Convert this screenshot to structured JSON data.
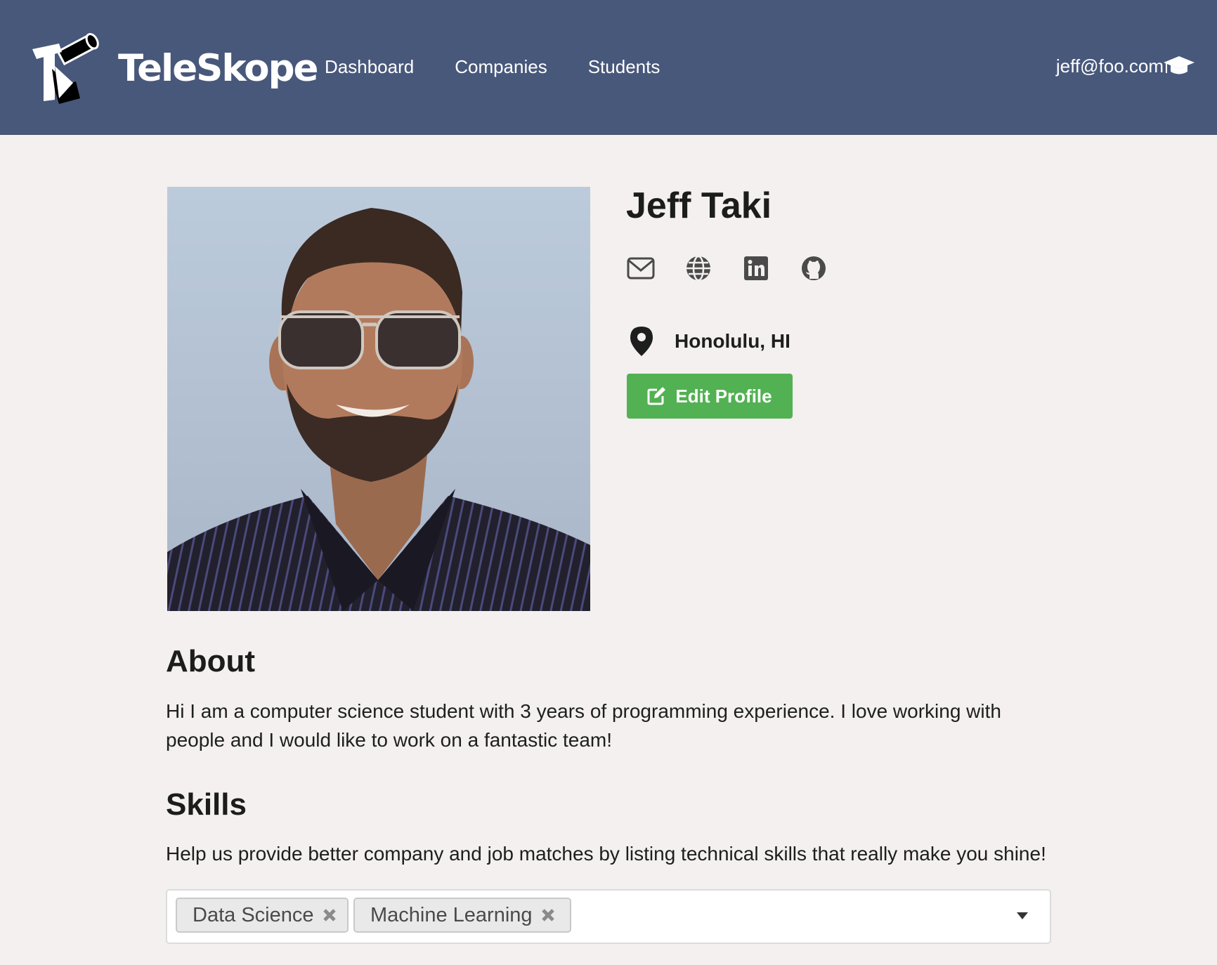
{
  "header": {
    "brand": "TeleSkope",
    "nav": [
      "Dashboard",
      "Companies",
      "Students"
    ],
    "user_email": "jeff@foo.com",
    "user_icon": "graduation-cap-icon",
    "bg_color": "#48587b"
  },
  "profile": {
    "name": "Jeff Taki",
    "social_icons": [
      "envelope-icon",
      "globe-icon",
      "linkedin-icon",
      "github-icon"
    ],
    "location": "Honolulu, HI",
    "edit_button": "Edit Profile",
    "edit_color": "#52b152"
  },
  "about": {
    "title": "About",
    "text": "Hi I am a computer science student with 3 years of programming experience. I love working with people and I would like to work on a fantastic team!"
  },
  "skills": {
    "title": "Skills",
    "help": "Help us provide better company and job matches by listing technical skills that really make you shine!",
    "tags": [
      "Data Science",
      "Machine Learning"
    ]
  }
}
